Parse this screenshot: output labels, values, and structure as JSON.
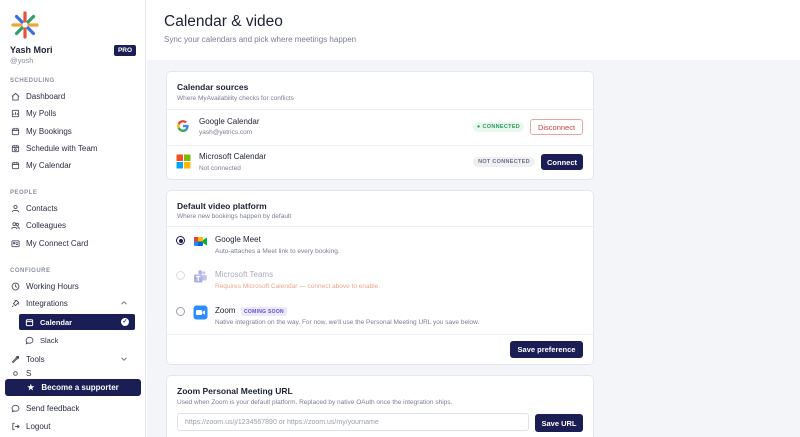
{
  "user": {
    "name": "Yash Mori",
    "handle": "@yosh",
    "plan": "PRO"
  },
  "sidebar": {
    "sections": [
      {
        "label": "SCHEDULING"
      },
      {
        "label": "PEOPLE"
      },
      {
        "label": "CONFIGURE"
      }
    ],
    "scheduling": [
      {
        "label": "Dashboard",
        "icon": "home-icon"
      },
      {
        "label": "My Polls",
        "icon": "poll-icon"
      },
      {
        "label": "My Bookings",
        "icon": "calendar-icon"
      },
      {
        "label": "Schedule with Team",
        "icon": "team-icon"
      },
      {
        "label": "My Calendar",
        "icon": "calendar-icon"
      }
    ],
    "people": [
      {
        "label": "Contacts",
        "icon": "user-icon"
      },
      {
        "label": "Colleagues",
        "icon": "users-icon"
      },
      {
        "label": "My Connect Card",
        "icon": "card-icon"
      }
    ],
    "configure": [
      {
        "label": "Working Hours",
        "icon": "clock-icon"
      },
      {
        "label": "Integrations",
        "icon": "plug-icon"
      },
      {
        "label": "Tools",
        "icon": "wrench-icon"
      }
    ],
    "integrations_sub": [
      {
        "label": "Calendar",
        "active": true
      },
      {
        "label": "Slack",
        "active": false
      }
    ],
    "partially_hidden_item": "S",
    "supporter_label": "Become a supporter",
    "footer": [
      {
        "label": "Send feedback",
        "icon": "chat-icon"
      },
      {
        "label": "Logout",
        "icon": "logout-icon"
      }
    ]
  },
  "header": {
    "title": "Calendar & video",
    "subtitle": "Sync your calendars and pick where meetings happen"
  },
  "calendar_sources": {
    "title": "Calendar sources",
    "subtitle": "Where MyAvailability checks for conflicts",
    "items": [
      {
        "name": "Google Calendar",
        "detail": "yash@yetrics.com",
        "status": "CONNECTED",
        "action": "Disconnect"
      },
      {
        "name": "Microsoft Calendar",
        "detail": "Not connected",
        "status": "NOT CONNECTED",
        "action": "Connect"
      }
    ]
  },
  "video_platform": {
    "title": "Default video platform",
    "subtitle": "Where new bookings happen by default",
    "options": [
      {
        "name": "Google Meet",
        "detail": "Auto-attaches a Meet link to every booking.",
        "selected": true,
        "disabled": false
      },
      {
        "name": "Microsoft Teams",
        "detail": "Requires Microsoft Calendar — connect above to enable.",
        "selected": false,
        "disabled": true
      },
      {
        "name": "Zoom",
        "badge": "COMING SOON",
        "detail": "Native integration on the way. For now, we'll use the Personal Meeting URL you save below.",
        "selected": false,
        "disabled": false
      }
    ],
    "save_label": "Save preference"
  },
  "zoom_url": {
    "title": "Zoom Personal Meeting URL",
    "subtitle": "Used when Zoom is your default platform. Replaced by native OAuth once the integration ships.",
    "placeholder": "https://zoom.us/j/1234567890 or https://zoom.us/my/yourname",
    "value": "",
    "save_label": "Save URL"
  },
  "colors": {
    "navy": "#1b1d55",
    "connected_green": "#2f9b5a",
    "disconnect_red": "#c9463a",
    "warning_text": "#e07a4a"
  }
}
